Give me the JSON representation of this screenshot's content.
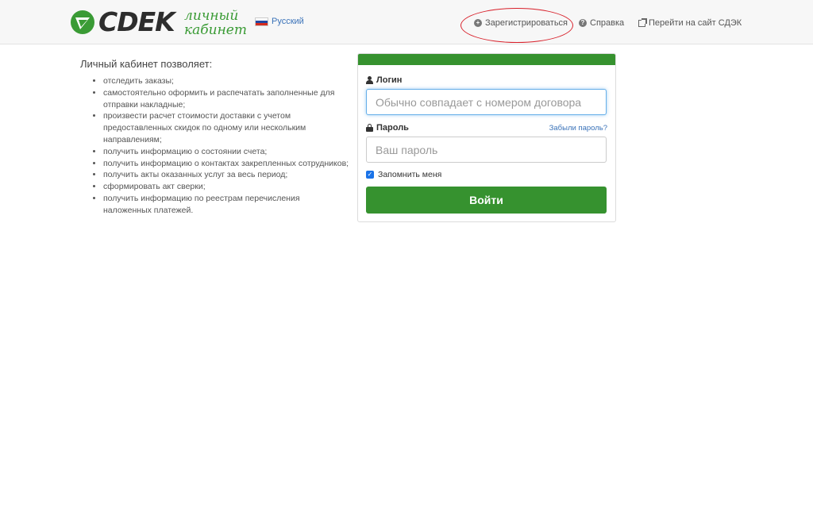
{
  "header": {
    "brand": "CDEK",
    "subtitle_line1": "личный",
    "subtitle_line2": "кабинет",
    "language": "Русский",
    "nav": {
      "register": "Зарегистрироваться",
      "help": "Справка",
      "go_to_site": "Перейти на сайт СДЭК"
    }
  },
  "intro": {
    "title": "Личный кабинет позволяет:",
    "features": [
      "отследить заказы;",
      "самостоятельно оформить и распечатать заполненные для отправки накладные;",
      "произвести расчет стоимости доставки с учетом предоставленных скидок по одному или нескольким направлениям;",
      "получить информацию о состоянии счета;",
      "получить информацию о контактах закрепленных сотрудников;",
      "получить акты оказанных услуг за весь период;",
      "сформировать акт сверки;",
      "получить информацию по реестрам перечисления наложенных платежей."
    ]
  },
  "login_form": {
    "login_label": "Логин",
    "login_placeholder": "Обычно совпадает с номером договора",
    "password_label": "Пароль",
    "forgot_link": "Забыли пароль?",
    "password_placeholder": "Ваш пароль",
    "remember_label": "Запомнить меня",
    "remember_checked": true,
    "submit_label": "Войти"
  },
  "colors": {
    "brand_green": "#36922f",
    "link_blue": "#3b73b9",
    "highlight_red": "#d8202a"
  },
  "icons": {
    "logo": "cdek-logo-icon",
    "register": "plus-circle-icon",
    "help": "question-circle-icon",
    "external": "external-link-icon",
    "user": "user-icon",
    "lock": "lock-icon"
  }
}
